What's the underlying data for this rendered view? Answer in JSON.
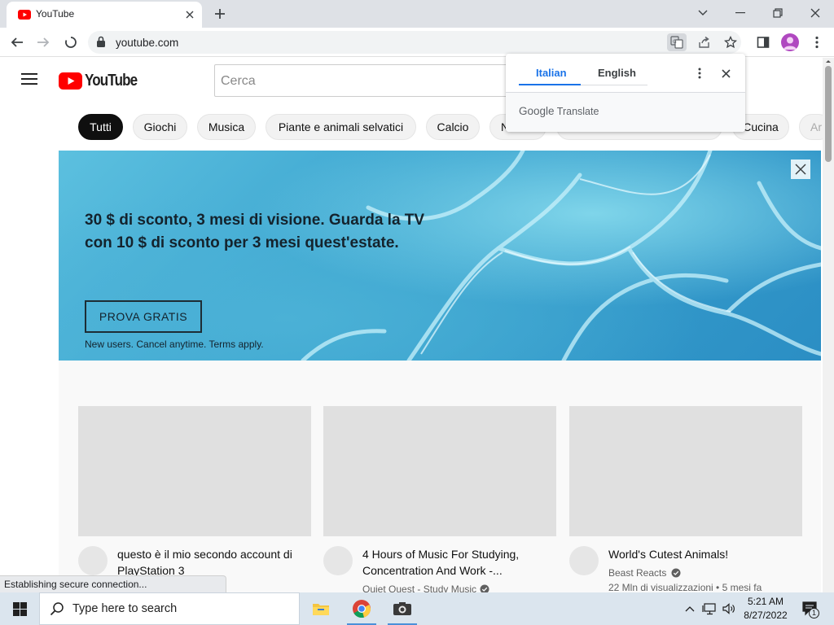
{
  "browser": {
    "tab_title": "YouTube",
    "url": "youtube.com",
    "new_tab_symbol": "+"
  },
  "youtube": {
    "logo_text": "YouTube",
    "search_placeholder": "Cerca",
    "chips": [
      "Tutti",
      "Giochi",
      "Musica",
      "Piante e animali selvatici",
      "Calcio",
      "N",
      "Cucina",
      "Ar"
    ],
    "active_chip": "Tutti"
  },
  "banner": {
    "headline_line1": "30 $ di sconto, 3 mesi di visione. Guarda la TV",
    "headline_line2": "con 10 $ di sconto per 3 mesi quest'estate.",
    "cta_label": "PROVA GRATIS",
    "fine_print": "New users. Cancel anytime. Terms apply."
  },
  "videos": [
    {
      "title": "questo è il mio secondo account di PlayStation 3",
      "channel": "",
      "meta": "",
      "verified": false
    },
    {
      "title": "4 Hours of Music For Studying, Concentration And Work -...",
      "channel": "Quiet Quest - Study Music",
      "meta": "",
      "verified": true
    },
    {
      "title": "World's Cutest Animals!",
      "channel": "Beast Reacts",
      "meta": "22 Mln di visualizzazioni • 5 mesi fa",
      "verified": true
    }
  ],
  "status_bar": "Establishing secure connection...",
  "translate_popup": {
    "source_lang": "Italian",
    "target_lang": "English",
    "brand_google": "Google",
    "brand_translate": "Translate"
  },
  "taskbar": {
    "search_placeholder": "Type here to search",
    "time": "5:21 AM",
    "date": "8/27/2022",
    "notification_count": "1"
  },
  "colors": {
    "youtube_red": "#ff0000",
    "translate_blue": "#1a73e8",
    "taskbar_bg": "#dbe5ee"
  }
}
